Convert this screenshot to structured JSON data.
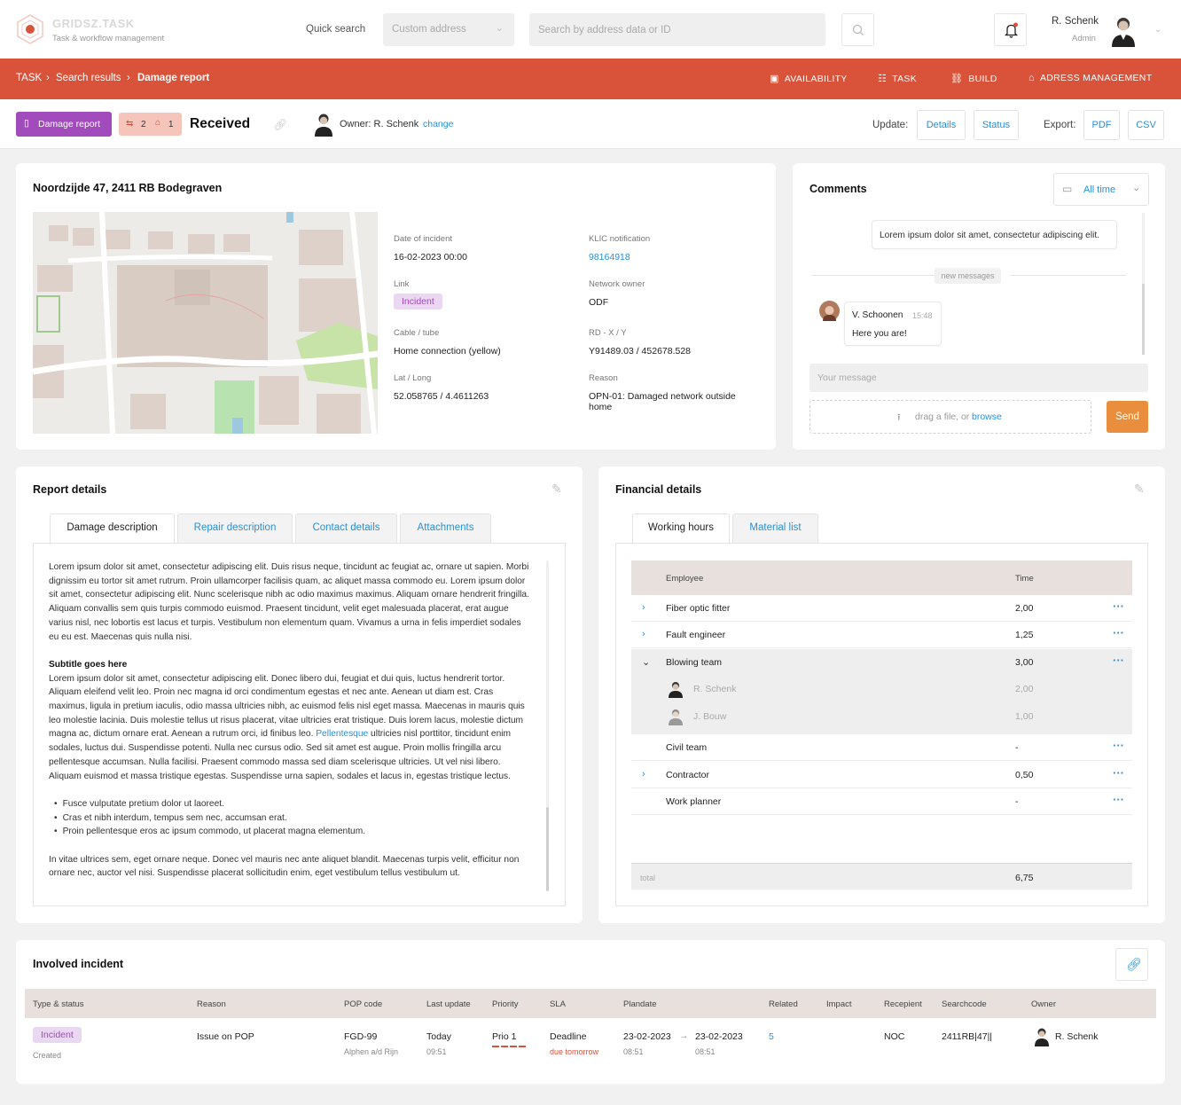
{
  "app": {
    "name": "GRIDSZ.TASK",
    "tagline": "Task & workflow management"
  },
  "header": {
    "quick_search_label": "Quick search",
    "address_select": "Custom address",
    "search_placeholder": "Search by address data or ID",
    "user_name": "R. Schenk",
    "user_role": "Admin"
  },
  "breadcrumb": [
    "TASK",
    "Search results",
    "Damage report"
  ],
  "nav": [
    {
      "label": "AVAILABILITY",
      "icon": "availability-icon"
    },
    {
      "label": "TASK",
      "icon": "task-icon"
    },
    {
      "label": "BUILD",
      "icon": "build-icon"
    },
    {
      "label": "ADRESS MANAGEMENT",
      "icon": "address-icon"
    }
  ],
  "action": {
    "report_button": "Damage report",
    "badge_tasks": "2",
    "badge_houses": "1",
    "status": "Received",
    "owner": "Owner: R. Schenk",
    "change": "change",
    "update_label": "Update:",
    "update_buttons": [
      "Details",
      "Status"
    ],
    "export_label": "Export:",
    "export_buttons": [
      "PDF",
      "CSV"
    ]
  },
  "location": {
    "address": "Noordzijde 47, 2411 RB Bodegraven",
    "fields": {
      "date_label": "Date of incident",
      "date": "16-02-2023 00:00",
      "klic_label": "KLIC notification",
      "klic": "98164918",
      "link_label": "Link",
      "link": "Incident",
      "network_owner_label": "Network owner",
      "network_owner": "ODF",
      "cable_label": "Cable / tube",
      "cable": "Home connection (yellow)",
      "rd_label": "RD - X / Y",
      "rd": "Y91489.03 / 452678.528",
      "latlong_label": "Lat / Long",
      "latlong": "52.058765 / 4.4611263",
      "reason_label": "Reason",
      "reason": "OPN-01: Damaged network outside home"
    }
  },
  "comments": {
    "title": "Comments",
    "period": "All time",
    "messages": [
      {
        "text": "Lorem ipsum dolor sit amet, consectetur adipiscing elit."
      },
      {
        "author": "V. Schoonen",
        "time": "15:48",
        "text": "Here you are!"
      }
    ],
    "divider": "new messages",
    "input_placeholder": "Your message",
    "drop_text": "drag a file, or",
    "browse": "browse",
    "send": "Send"
  },
  "report": {
    "title": "Report details",
    "tabs": [
      "Damage description",
      "Repair description",
      "Contact details",
      "Attachments"
    ],
    "p1": "Lorem ipsum dolor sit amet, consectetur adipiscing elit. Duis risus neque, tincidunt ac feugiat ac, ornare ut sapien. Morbi dignissim eu tortor sit amet rutrum. Proin ullamcorper facilisis quam, ac aliquet massa commodo eu. Lorem ipsum dolor sit amet, consectetur adipiscing elit. Nunc scelerisque nibh ac odio maximus maximus. Aliquam ornare hendrerit fringilla. Aliquam convallis sem quis turpis commodo euismod. Praesent tincidunt, velit eget malesuada placerat, erat augue varius nisl, nec lobortis est lacus et turpis. Vestibulum non elementum quam. Vivamus a urna in felis imperdiet sodales eu eu est. Maecenas quis nulla nisi.",
    "subtitle": "Subtitle goes here",
    "p2a": "Lorem ipsum dolor sit amet, consectetur adipiscing elit. Donec libero dui, feugiat et dui quis, luctus hendrerit tortor. Aliquam eleifend velit leo. Proin nec magna id orci condimentum egestas et nec ante. Aenean ut diam est. Cras maximus, ligula in pretium iaculis, odio massa ultricies nibh, ac euismod felis nisl eget massa. Maecenas in mauris quis leo molestie lacinia. Duis molestie tellus ut risus placerat, vitae ultricies erat tristique. Duis lorem lacus, molestie dictum magna ac, dictum ornare erat. Aenean a rutrum orci, id finibus leo.",
    "p2_link": "Pellentesque",
    "p2b": "ultricies nisl porttitor, tincidunt enim sodales, luctus dui. Suspendisse potenti. Nulla nec cursus odio. Sed sit amet est augue. Proin mollis fringilla arcu pellentesque accumsan. Nulla facilisi. Praesent commodo massa sed diam scelerisque ultricies. Ut vel nisi libero. Aliquam euismod et massa tristique egestas. Suspendisse urna sapien, sodales et lacus in, egestas tristique lectus.",
    "bullets": [
      "Fusce vulputate pretium dolor ut laoreet.",
      "Cras et nibh interdum, tempus sem nec, accumsan erat.",
      "Proin pellentesque eros ac ipsum commodo, ut placerat magna elementum."
    ],
    "p3": "In vitae ultrices sem, eget ornare neque. Donec vel mauris nec ante aliquet blandit. Maecenas turpis velit, efficitur non ornare nec, auctor vel nisi. Suspendisse placerat sollicitudin enim, eget vestibulum tellus vestibulum ut."
  },
  "financial": {
    "title": "Financial details",
    "tabs": [
      "Working hours",
      "Material list"
    ],
    "col_employee": "Employee",
    "col_time": "Time",
    "rows": [
      {
        "name": "Fiber optic fitter",
        "time": "2,00"
      },
      {
        "name": "Fault engineer",
        "time": "1,25"
      },
      {
        "name": "Blowing team",
        "time": "3,00"
      },
      {
        "name": "R. Schenk",
        "time": "2,00"
      },
      {
        "name": "J. Bouw",
        "time": "1,00"
      },
      {
        "name": "Civil team",
        "time": "-"
      },
      {
        "name": "Contractor",
        "time": "0,50"
      },
      {
        "name": "Work planner",
        "time": "-"
      }
    ],
    "total_label": "total",
    "total": "6,75"
  },
  "incident": {
    "title": "Involved incident",
    "headers": [
      "Type & status",
      "Reason",
      "POP code",
      "Last update",
      "Priority",
      "SLA",
      "Plandate",
      "Related",
      "Impact",
      "Recepient",
      "Searchcode",
      "Owner"
    ],
    "type": "Incident",
    "status": "Created",
    "reason": "Issue on POP",
    "pop_code": "FGD-99",
    "pop_place": "Alphen a/d Rijn",
    "last_update": "Today",
    "last_update_time": "09:51",
    "priority": "Prio 1",
    "sla": "Deadline",
    "sla_note": "due tomorrow",
    "plan_from": "23-02-2023",
    "plan_from_time": "08:51",
    "plan_to": "23-02-2023",
    "plan_to_time": "08:51",
    "related": "5",
    "recipient": "NOC",
    "searchcode": "2411RB|47||",
    "owner": "R. Schenk"
  },
  "colors": {
    "brand": "#d9533b",
    "accent": "#2b8fd6",
    "purple": "#a14bbd",
    "send": "#e98e3c"
  }
}
